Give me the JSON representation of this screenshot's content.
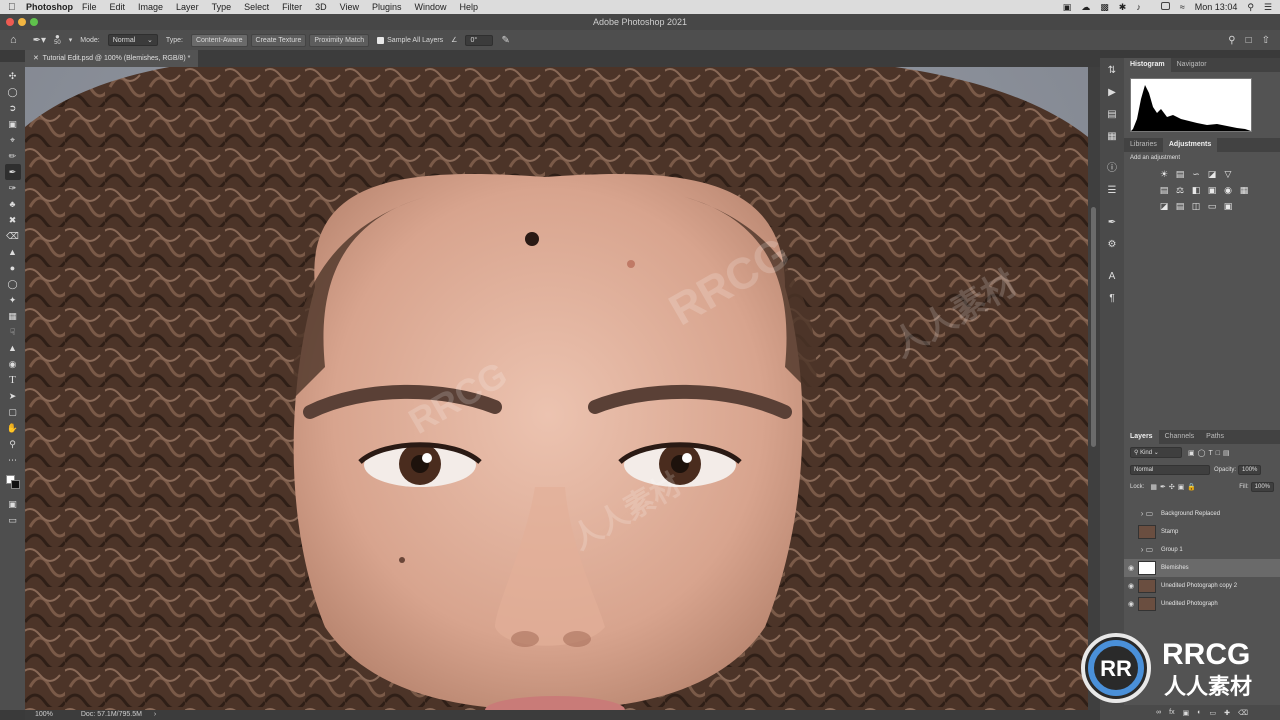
{
  "menubar": {
    "app_name": "Photoshop",
    "items": [
      "File",
      "Edit",
      "Image",
      "Layer",
      "Type",
      "Select",
      "Filter",
      "3D",
      "View",
      "Plugins",
      "Window",
      "Help"
    ],
    "clock": "Mon 13:04"
  },
  "window": {
    "title": "Adobe Photoshop 2021"
  },
  "options_bar": {
    "brush_size": "50",
    "mode_label": "Mode:",
    "mode_value": "Normal",
    "type_label": "Type:",
    "content_aware": "Content-Aware",
    "create_texture": "Create Texture",
    "proximity_match": "Proximity Match",
    "sample_all_layers": "Sample All Layers",
    "angle_value": "0°"
  },
  "document": {
    "tab_title": "Tutorial Edit.psd @ 100% (Blemishes, RGB/8) *"
  },
  "status_bar": {
    "zoom": "100%",
    "doc_info": "Doc: 57.1M/795.5M"
  },
  "panels": {
    "top_tabs": [
      "Histogram",
      "Navigator"
    ],
    "mid_tabs": [
      "Libraries",
      "Adjustments"
    ],
    "add_adjustment": "Add an adjustment",
    "layer_tabs": [
      "Layers",
      "Channels",
      "Paths"
    ],
    "kind_label": "Kind",
    "blend_mode": "Normal",
    "opacity_label": "Opacity:",
    "opacity_value": "100%",
    "lock_label": "Lock:",
    "fill_label": "Fill:",
    "fill_value": "100%"
  },
  "layers": [
    {
      "name": "Background Replaced",
      "type": "group",
      "visible": false
    },
    {
      "name": "Stamp",
      "type": "pixel",
      "visible": false
    },
    {
      "name": "Group 1",
      "type": "group",
      "visible": false
    },
    {
      "name": "Blemishes",
      "type": "white",
      "visible": true,
      "selected": true
    },
    {
      "name": "Unedited Photograph copy 2",
      "type": "pixel",
      "visible": true
    },
    {
      "name": "Unedited Photograph",
      "type": "pixel",
      "visible": true
    }
  ],
  "watermark": {
    "text_latin": "RRCG",
    "text_cn": "人人素材"
  },
  "colors": {
    "panel_bg": "#535353",
    "selected_layer": "#6a6a6a",
    "skin": "#d7a08a",
    "hair": "#4c3428"
  }
}
